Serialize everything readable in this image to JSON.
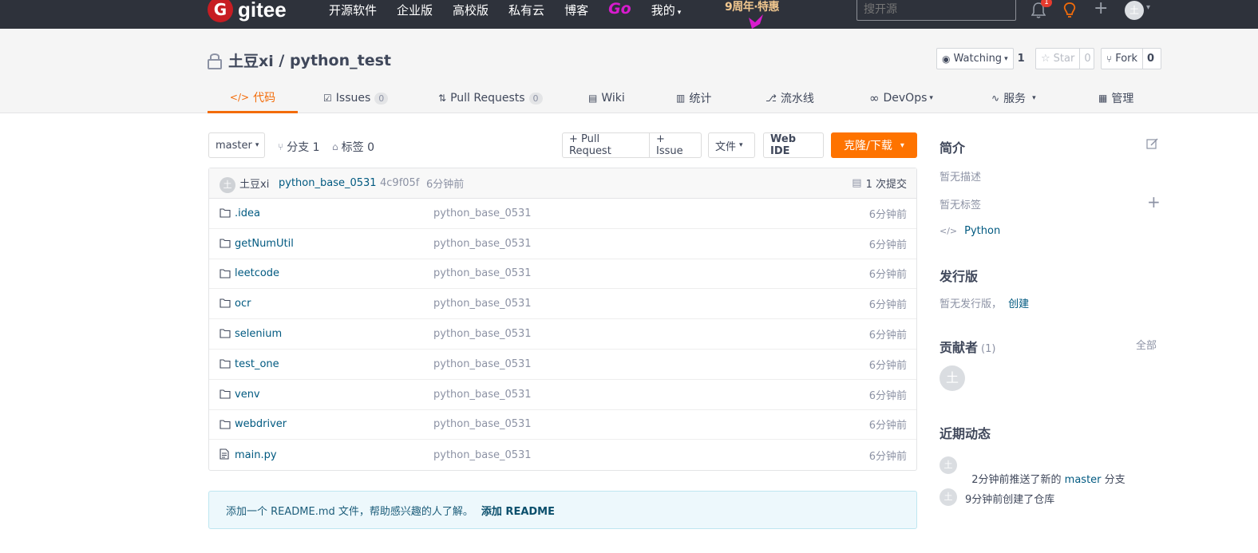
{
  "topbar": {
    "logo_mark": "G",
    "logo_text": "gitee",
    "nav": [
      "开源软件",
      "企业版",
      "高校版",
      "私有云",
      "博客"
    ],
    "go_label": "Go",
    "my_label": "我的",
    "promo": "9周年·特惠",
    "search_placeholder": "搜开源",
    "notification_count": "1",
    "avatar_initial": "土"
  },
  "repo": {
    "owner": "土豆xi",
    "separator": " / ",
    "name": "python_test",
    "watch_label": "Watching",
    "watch_count": "1",
    "star_label": "Star",
    "star_count": "0",
    "fork_label": "Fork",
    "fork_count": "0"
  },
  "tabs": [
    {
      "label": "代码",
      "icon": "code-icon"
    },
    {
      "label": "Issues",
      "count": "0",
      "icon": "issues-icon"
    },
    {
      "label": "Pull Requests",
      "count": "0",
      "icon": "pull-request-icon"
    },
    {
      "label": "Wiki",
      "icon": "wiki-icon"
    },
    {
      "label": "统计",
      "icon": "stats-icon"
    },
    {
      "label": "流水线",
      "icon": "pipeline-icon"
    },
    {
      "label": "DevOps",
      "icon": "devops-icon"
    },
    {
      "label": "服务",
      "icon": "service-icon"
    },
    {
      "label": "管理",
      "icon": "manage-icon"
    }
  ],
  "toolbar": {
    "branch": "master",
    "branches_label": "分支 1",
    "tags_label": "标签 0",
    "pull_request_btn": "+ Pull Request",
    "issue_btn": "+ Issue",
    "file_btn": "文件",
    "webide_btn": "Web IDE",
    "clone_btn": "克隆/下载"
  },
  "commit": {
    "author_initial": "土",
    "author": "土豆xi",
    "message": "python_base_0531",
    "hash": "4c9f05f",
    "time": "6分钟前",
    "commits_label": "1 次提交"
  },
  "files": [
    {
      "name": ".idea",
      "type": "folder",
      "commit": "python_base_0531",
      "time": "6分钟前"
    },
    {
      "name": "getNumUtil",
      "type": "folder",
      "commit": "python_base_0531",
      "time": "6分钟前"
    },
    {
      "name": "leetcode",
      "type": "folder",
      "commit": "python_base_0531",
      "time": "6分钟前"
    },
    {
      "name": "ocr",
      "type": "folder",
      "commit": "python_base_0531",
      "time": "6分钟前"
    },
    {
      "name": "selenium",
      "type": "folder",
      "commit": "python_base_0531",
      "time": "6分钟前"
    },
    {
      "name": "test_one",
      "type": "folder",
      "commit": "python_base_0531",
      "time": "6分钟前"
    },
    {
      "name": "venv",
      "type": "folder",
      "commit": "python_base_0531",
      "time": "6分钟前"
    },
    {
      "name": "webdriver",
      "type": "folder",
      "commit": "python_base_0531",
      "time": "6分钟前"
    },
    {
      "name": "main.py",
      "type": "file",
      "commit": "python_base_0531",
      "time": "6分钟前"
    }
  ],
  "readme": {
    "text": "添加一个 README.md 文件，帮助感兴趣的人了解。",
    "link": "添加 README"
  },
  "sidebar": {
    "intro_title": "简介",
    "no_description": "暂无描述",
    "no_tags": "暂无标签",
    "language": "Python",
    "releases_title": "发行版",
    "no_releases": "暂无发行版，",
    "create_link": "创建",
    "contributors_title": "贡献者",
    "contributors_count": "(1)",
    "all_link": "全部",
    "contributor_initial": "土",
    "activity_title": "近期动态",
    "activity": [
      {
        "pre": "2分钟前推送了新的 ",
        "link": "master",
        "post": " 分支",
        "initial": "土"
      },
      {
        "pre": "9分钟前创建了仓库",
        "link": "",
        "post": "",
        "initial": "土"
      }
    ]
  },
  "colors": {
    "accent": "#f36c0a",
    "link": "#005980",
    "topbar": "#2e323b",
    "clone_button": "#fe7300"
  }
}
